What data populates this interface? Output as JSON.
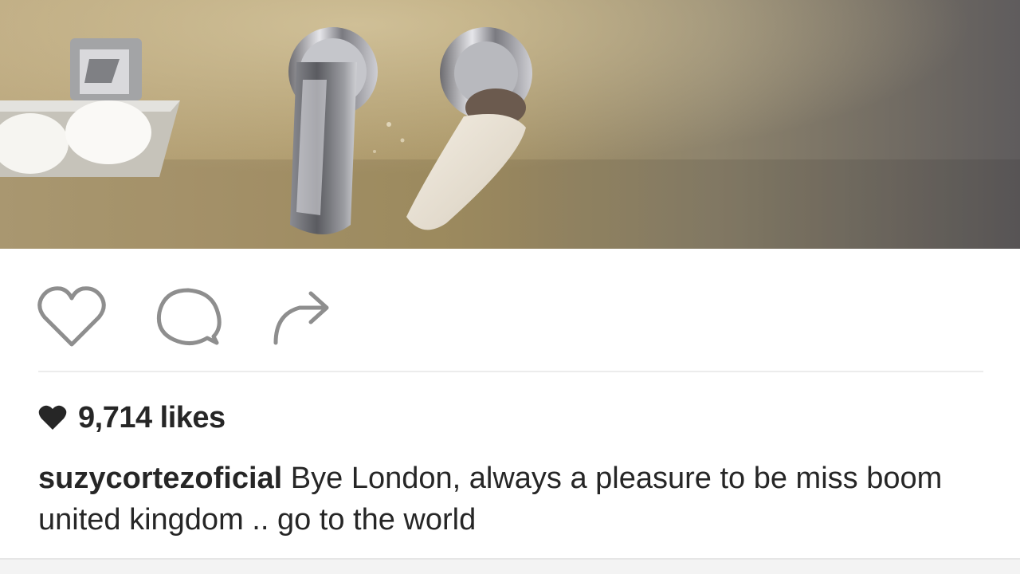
{
  "post": {
    "likes_label": "9,714 likes",
    "username": "suzycortezoficial",
    "caption_text": "Bye London, always a pleasure to be miss boom united kingdom .. go to the world"
  },
  "actions": {
    "like_icon": "heart-outline-icon",
    "comment_icon": "speech-bubble-icon",
    "share_icon": "share-arrow-icon"
  },
  "colors": {
    "text": "#262626",
    "icon": "#8e8e8e",
    "divider": "#ececec"
  }
}
